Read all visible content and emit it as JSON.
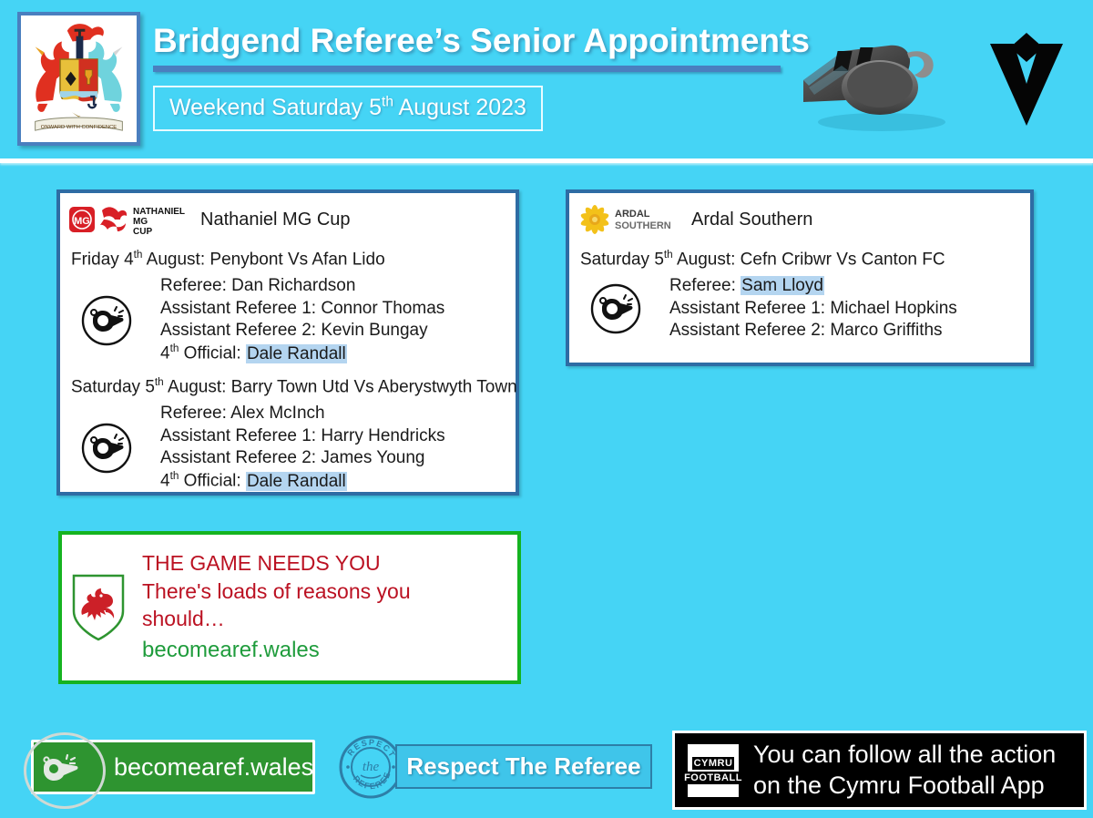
{
  "header": {
    "title": "Bridgend Referee’s Senior Appointments",
    "date_prefix": "Weekend Saturday 5",
    "date_suffix_sup": "th",
    "date_rest": " August 2023",
    "crest_alt": "bridgend-coat-of-arms",
    "crest_motto": "ONWARD WITH CONFIDENCE",
    "whistle_photo_alt": "whistle-photograph",
    "chevron_alt": "referee-chevron-logo"
  },
  "colors": {
    "background": "#45d4f5",
    "panel_border": "#2e6ca4",
    "title_rule": "#4a7fbf",
    "recruit_border": "#15b320",
    "recruit_text": "#bb1122",
    "recruit_url": "#1f9c3c",
    "highlight": "#b4d5f0",
    "becomearef_green": "#2e9430",
    "respect_blue": "#3fc5ea"
  },
  "panels": [
    {
      "id": "nathaniel-mg-cup",
      "competition": "Nathaniel MG Cup",
      "logo_lines": [
        "NATHANIEL",
        "MG",
        "CUP"
      ],
      "logo_badge": "MG",
      "fixtures": [
        {
          "day": "Friday 4",
          "day_sup": "th",
          "rest": " August: Penybont Vs Afan Lido",
          "officials": [
            {
              "role": "Referee: ",
              "name": "Dan Richardson",
              "highlight": false
            },
            {
              "role": "Assistant Referee 1: ",
              "name": "Connor Thomas",
              "highlight": false
            },
            {
              "role": "Assistant Referee 2: ",
              "name": "Kevin Bungay",
              "highlight": false
            },
            {
              "role": "4th Official: ",
              "role_pre": "4",
              "role_sup": "th",
              "role_post": " Official: ",
              "name": "Dale Randall",
              "highlight": true
            }
          ]
        },
        {
          "day": "Saturday 5",
          "day_sup": "th",
          "rest": " August: Barry Town Utd Vs Aberystwyth Town",
          "officials": [
            {
              "role": "Referee: ",
              "name": "Alex McInch",
              "highlight": false
            },
            {
              "role": "Assistant Referee 1: ",
              "name": "Harry Hendricks",
              "highlight": false
            },
            {
              "role": "Assistant Referee 2: ",
              "name": "James Young",
              "highlight": false
            },
            {
              "role": "4th Official: ",
              "role_pre": "4",
              "role_sup": "th",
              "role_post": " Official: ",
              "name": "Dale Randall",
              "highlight": true
            }
          ]
        }
      ]
    },
    {
      "id": "ardal-southern",
      "competition": "Ardal Southern",
      "logo_lines": [
        "ARDAL",
        "SOUTHERN"
      ],
      "fixtures": [
        {
          "day": "Saturday 5",
          "day_sup": "th",
          "rest": " August: Cefn Cribwr Vs Canton FC",
          "officials": [
            {
              "role": "Referee: ",
              "name": "Sam Lloyd",
              "highlight": true
            },
            {
              "role": "Assistant Referee 1: ",
              "name": "Michael Hopkins",
              "highlight": false
            },
            {
              "role": "Assistant Referee 2: ",
              "name": "Marco Griffiths",
              "highlight": false
            }
          ]
        }
      ]
    }
  ],
  "recruit": {
    "line1": "THE GAME NEEDS YOU",
    "line2": "There's loads of reasons you",
    "line3": "should…",
    "url": "becomearef.wales",
    "shield_alt": "wales-dragon-shield"
  },
  "footer": {
    "becomearef_label": "becomearef.wales",
    "respect_label": "Respect The Referee",
    "respect_stamp_words": [
      "RESPECT",
      "the",
      "REFEREE"
    ],
    "cymru_logo_words": [
      "CYMRU",
      "FOOTBALL"
    ],
    "cymru_line1": "You can follow all the action",
    "cymru_line2": "on the Cymru Football App"
  }
}
